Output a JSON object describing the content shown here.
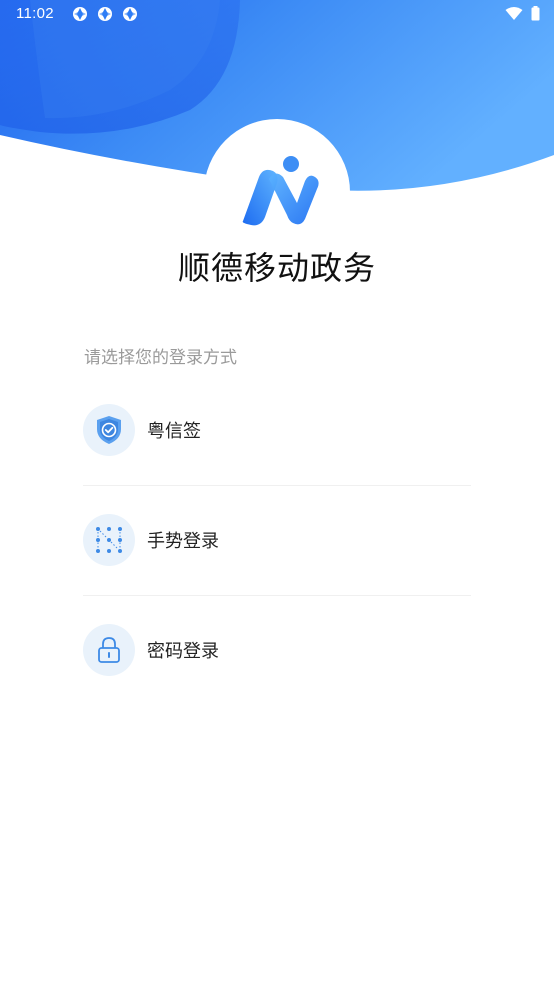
{
  "status_bar": {
    "time": "11:02"
  },
  "app": {
    "title": "顺德移动政务"
  },
  "login": {
    "prompt": "请选择您的登录方式",
    "options": [
      {
        "label": "粤信签",
        "icon": "shield-check-icon"
      },
      {
        "label": "手势登录",
        "icon": "gesture-grid-icon"
      },
      {
        "label": "密码登录",
        "icon": "lock-icon"
      }
    ]
  },
  "colors": {
    "header_blue": "#2f7df6",
    "header_blue_light": "#5aa7ff",
    "icon_bg": "#e9f2fb",
    "icon_blue": "#3d8ae6",
    "title_text": "#111111",
    "prompt_text": "#9a9a9a"
  }
}
